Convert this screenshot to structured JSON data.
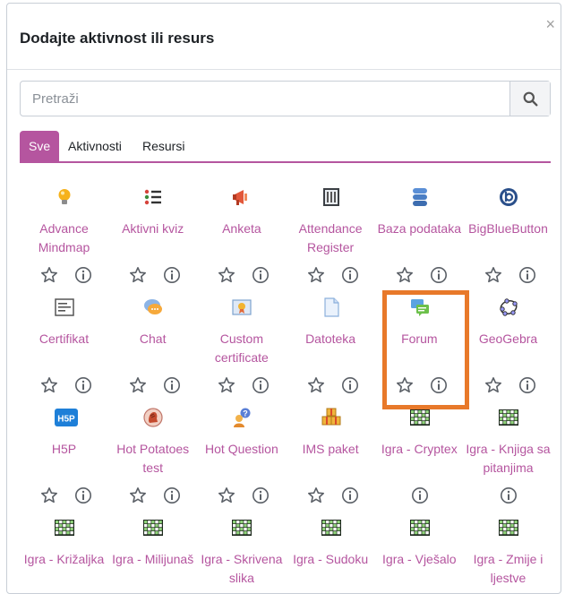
{
  "modal": {
    "title": "Dodajte aktivnost ili resurs",
    "close_label": "×",
    "search_placeholder": "Pretraži"
  },
  "tabs": [
    {
      "label": "Sve",
      "active": true
    },
    {
      "label": "Aktivnosti",
      "active": false
    },
    {
      "label": "Resursi",
      "active": false
    }
  ],
  "colors": {
    "accent": "#b5559f",
    "highlight": "#e8792a"
  },
  "items": [
    {
      "name": "Advance Mindmap",
      "icon": "lightbulb-icon",
      "star": true,
      "info": true
    },
    {
      "name": "Aktivni kviz",
      "icon": "list-icon",
      "star": true,
      "info": true
    },
    {
      "name": "Anketa",
      "icon": "megaphone-icon",
      "star": true,
      "info": true
    },
    {
      "name": "Attendance Register",
      "icon": "register-icon",
      "star": true,
      "info": true
    },
    {
      "name": "Baza podataka",
      "icon": "database-icon",
      "star": true,
      "info": true
    },
    {
      "name": "BigBlueButton",
      "icon": "bigbluebutton-icon",
      "star": true,
      "info": true
    },
    {
      "name": "Certifikat",
      "icon": "certificate-icon",
      "star": true,
      "info": true
    },
    {
      "name": "Chat",
      "icon": "chat-icon",
      "star": true,
      "info": true
    },
    {
      "name": "Custom certificate",
      "icon": "custom-certificate-icon",
      "star": true,
      "info": true
    },
    {
      "name": "Datoteka",
      "icon": "file-icon",
      "star": true,
      "info": true
    },
    {
      "name": "Forum",
      "icon": "forum-icon",
      "star": true,
      "info": true,
      "highlighted": true
    },
    {
      "name": "GeoGebra",
      "icon": "geogebra-icon",
      "star": true,
      "info": true
    },
    {
      "name": "H5P",
      "icon": "h5p-icon",
      "star": true,
      "info": true
    },
    {
      "name": "Hot Potatoes test",
      "icon": "hot-potatoes-icon",
      "star": true,
      "info": true
    },
    {
      "name": "Hot Question",
      "icon": "hot-question-icon",
      "star": true,
      "info": true
    },
    {
      "name": "IMS paket",
      "icon": "ims-package-icon",
      "star": true,
      "info": true
    },
    {
      "name": "Igra - Cryptex",
      "icon": "game-grid-icon",
      "star": false,
      "info": true
    },
    {
      "name": "Igra - Knjiga sa pitanjima",
      "icon": "game-grid-icon",
      "star": false,
      "info": true
    },
    {
      "name": "Igra - Križaljka",
      "icon": "game-grid-icon",
      "star": false,
      "info": false
    },
    {
      "name": "Igra - Milijunaš",
      "icon": "game-grid-icon",
      "star": false,
      "info": false
    },
    {
      "name": "Igra - Skrivena slika",
      "icon": "game-grid-icon",
      "star": false,
      "info": false
    },
    {
      "name": "Igra - Sudoku",
      "icon": "game-grid-icon",
      "star": false,
      "info": false
    },
    {
      "name": "Igra - Vješalo",
      "icon": "game-grid-icon",
      "star": false,
      "info": false
    },
    {
      "name": "Igra - Zmije i ljestve",
      "icon": "game-grid-icon",
      "star": false,
      "info": false
    }
  ]
}
